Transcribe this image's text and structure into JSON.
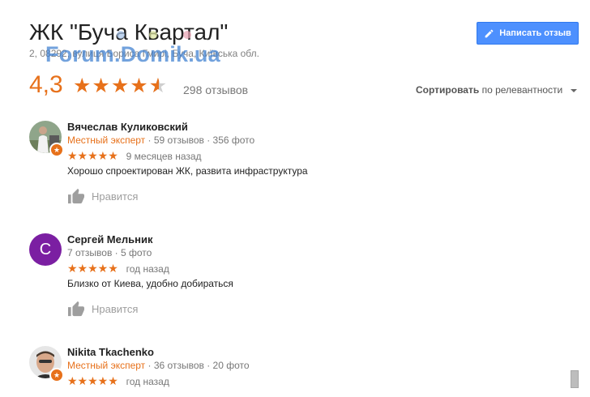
{
  "place": {
    "title": "ЖК \"Буча Квартал\"",
    "address": "2, 08292, вулиця Бориса Гмирі, Буча, Київська обл."
  },
  "watermark": {
    "text": "Forum.Domik.ua",
    "dot_colors": [
      "#a8c4e8",
      "#dfe7a1",
      "#e8a4b4"
    ]
  },
  "actions": {
    "write_review_label": "Написать отзыв",
    "write_review_icon": "pencil-icon"
  },
  "summary": {
    "rating": "4,3",
    "rating_value": 4.3,
    "review_count": "298 отзывов"
  },
  "sort": {
    "label": "Сортировать",
    "value": "по релевантности"
  },
  "colors": {
    "accent": "#e7711b",
    "button": "#4d90fe",
    "avatar_letter_bg": "#7b1fa2"
  },
  "reviews": [
    {
      "name": "Вячеслав Куликовский",
      "expert": "Местный эксперт",
      "stats": "59 отзывов · 356 фото",
      "stars": "★★★★★",
      "rating": 5,
      "time": "9 месяцев назад",
      "text": "Хорошо спроектирован ЖК, развита инфраструктура",
      "like_label": "Нравится",
      "avatar_type": "photo"
    },
    {
      "name": "Сергей Мельник",
      "avatar_letter": "С",
      "stats": "7 отзывов · 5 фото",
      "stars": "★★★★★",
      "rating": 5,
      "time": "год назад",
      "text": "Близко от Киева, удобно добираться",
      "like_label": "Нравится",
      "avatar_type": "letter"
    },
    {
      "name": "Nikita Tkachenko",
      "expert": "Местный эксперт",
      "stats": "36 отзывов · 20 фото",
      "stars": "★★★★★",
      "rating": 5,
      "time": "год назад",
      "avatar_type": "photo"
    }
  ]
}
